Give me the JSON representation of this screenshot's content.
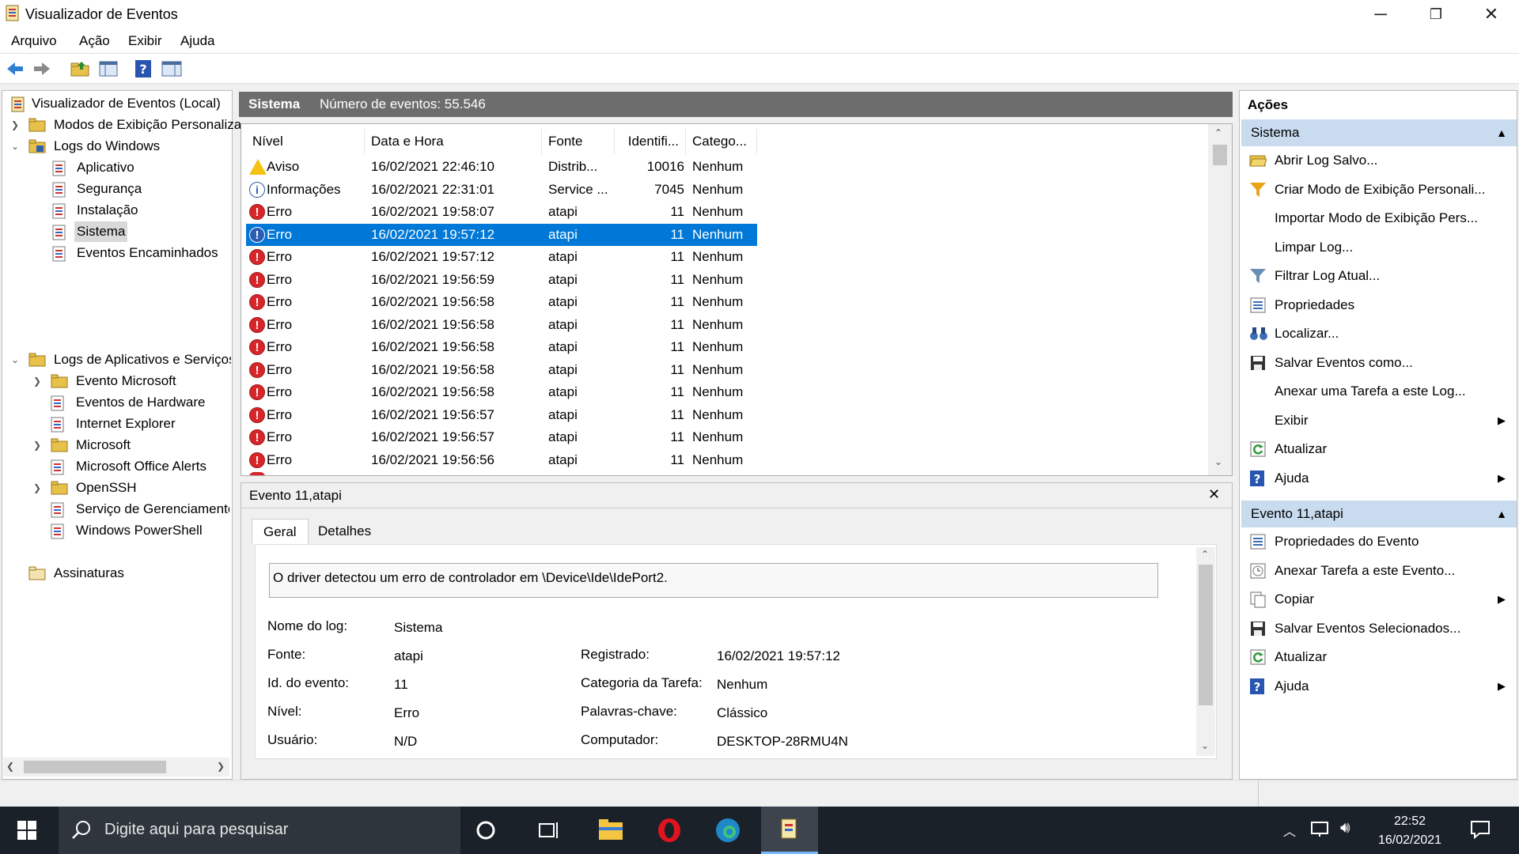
{
  "window": {
    "title": "Visualizador de Eventos",
    "min": "─",
    "max": "❐",
    "close": "✕"
  },
  "menu": [
    "Arquivo",
    "Ação",
    "Exibir",
    "Ajuda"
  ],
  "tree": {
    "root": "Visualizador de Eventos (Local)",
    "custom_views": "Modos de Exibição Personaliza",
    "windows_logs": "Logs do Windows",
    "win_items": [
      "Aplicativo",
      "Segurança",
      "Instalação",
      "Sistema",
      "Eventos Encaminhados"
    ],
    "app_logs": "Logs de Aplicativos e Serviços",
    "app_items": [
      "Evento Microsoft",
      "Eventos de Hardware",
      "Internet Explorer",
      "Microsoft",
      "Microsoft Office Alerts",
      "OpenSSH",
      "Serviço de Gerenciamento",
      "Windows PowerShell"
    ],
    "subscriptions": "Assinaturas"
  },
  "list": {
    "title": "Sistema",
    "count": "Número de eventos: 55.546",
    "columns": [
      "Nível",
      "Data e Hora",
      "Fonte",
      "Identifi...",
      "Catego..."
    ],
    "rows": [
      {
        "level": "warn",
        "level_text": "Aviso",
        "date": "16/02/2021 22:46:10",
        "source": "Distrib...",
        "id": "10016",
        "cat": "Nenhum"
      },
      {
        "level": "inf",
        "level_text": "Informações",
        "date": "16/02/2021 22:31:01",
        "source": "Service ...",
        "id": "7045",
        "cat": "Nenhum"
      },
      {
        "level": "err",
        "level_text": "Erro",
        "date": "16/02/2021 19:58:07",
        "source": "atapi",
        "id": "11",
        "cat": "Nenhum"
      },
      {
        "level": "err",
        "level_text": "Erro",
        "date": "16/02/2021 19:57:12",
        "source": "atapi",
        "id": "11",
        "cat": "Nenhum",
        "selected": true
      },
      {
        "level": "err",
        "level_text": "Erro",
        "date": "16/02/2021 19:57:12",
        "source": "atapi",
        "id": "11",
        "cat": "Nenhum"
      },
      {
        "level": "err",
        "level_text": "Erro",
        "date": "16/02/2021 19:56:59",
        "source": "atapi",
        "id": "11",
        "cat": "Nenhum"
      },
      {
        "level": "err",
        "level_text": "Erro",
        "date": "16/02/2021 19:56:58",
        "source": "atapi",
        "id": "11",
        "cat": "Nenhum"
      },
      {
        "level": "err",
        "level_text": "Erro",
        "date": "16/02/2021 19:56:58",
        "source": "atapi",
        "id": "11",
        "cat": "Nenhum"
      },
      {
        "level": "err",
        "level_text": "Erro",
        "date": "16/02/2021 19:56:58",
        "source": "atapi",
        "id": "11",
        "cat": "Nenhum"
      },
      {
        "level": "err",
        "level_text": "Erro",
        "date": "16/02/2021 19:56:58",
        "source": "atapi",
        "id": "11",
        "cat": "Nenhum"
      },
      {
        "level": "err",
        "level_text": "Erro",
        "date": "16/02/2021 19:56:58",
        "source": "atapi",
        "id": "11",
        "cat": "Nenhum"
      },
      {
        "level": "err",
        "level_text": "Erro",
        "date": "16/02/2021 19:56:57",
        "source": "atapi",
        "id": "11",
        "cat": "Nenhum"
      },
      {
        "level": "err",
        "level_text": "Erro",
        "date": "16/02/2021 19:56:57",
        "source": "atapi",
        "id": "11",
        "cat": "Nenhum"
      },
      {
        "level": "err",
        "level_text": "Erro",
        "date": "16/02/2021 19:56:56",
        "source": "atapi",
        "id": "11",
        "cat": "Nenhum"
      }
    ]
  },
  "detail": {
    "title": "Evento 11,atapi",
    "close": "✕",
    "tabs": [
      "Geral",
      "Detalhes"
    ],
    "message": "O driver detectou um erro de controlador em \\Device\\Ide\\IdePort2.",
    "left": [
      {
        "k": "Nome do log:",
        "v": "Sistema"
      },
      {
        "k": "Fonte:",
        "v": "atapi"
      },
      {
        "k": "Id. do evento:",
        "v": "11"
      },
      {
        "k": "Nível:",
        "v": "Erro"
      },
      {
        "k": "Usuário:",
        "v": "N/D"
      }
    ],
    "right": [
      {
        "k": "Registrado:",
        "v": "16/02/2021 19:57:12"
      },
      {
        "k": "Categoria da Tarefa:",
        "v": "Nenhum"
      },
      {
        "k": "Palavras-chave:",
        "v": "Clássico"
      },
      {
        "k": "Computador:",
        "v": "DESKTOP-28RMU4N"
      }
    ]
  },
  "actions": {
    "title": "Ações",
    "section1": "Sistema",
    "items1": [
      {
        "label": "Abrir Log Salvo...",
        "icon": "open-folder-icon"
      },
      {
        "label": "Criar Modo de Exibição Personali...",
        "icon": "filter-create-icon"
      },
      {
        "label": "Importar Modo de Exibição Pers...",
        "icon": ""
      },
      {
        "label": "Limpar Log...",
        "icon": ""
      },
      {
        "label": "Filtrar Log Atual...",
        "icon": "filter-icon"
      },
      {
        "label": "Propriedades",
        "icon": "properties-icon"
      },
      {
        "label": "Localizar...",
        "icon": "binoculars-icon"
      },
      {
        "label": "Salvar Eventos como...",
        "icon": "save-icon"
      },
      {
        "label": "Anexar uma Tarefa a este Log...",
        "icon": ""
      },
      {
        "label": "Exibir",
        "icon": "",
        "sub": true
      },
      {
        "label": "Atualizar",
        "icon": "refresh-icon"
      },
      {
        "label": "Ajuda",
        "icon": "help-icon",
        "sub": true
      }
    ],
    "section2": "Evento 11,atapi",
    "items2": [
      {
        "label": "Propriedades do Evento",
        "icon": "properties-icon"
      },
      {
        "label": "Anexar Tarefa a este Evento...",
        "icon": "task-icon"
      },
      {
        "label": "Copiar",
        "icon": "copy-icon",
        "sub": true
      },
      {
        "label": "Salvar Eventos Selecionados...",
        "icon": "save-icon"
      },
      {
        "label": "Atualizar",
        "icon": "refresh-icon"
      },
      {
        "label": "Ajuda",
        "icon": "help-icon",
        "sub": true
      }
    ]
  },
  "taskbar": {
    "search_placeholder": "Digite aqui para pesquisar",
    "time": "22:52",
    "date": "16/02/2021"
  }
}
